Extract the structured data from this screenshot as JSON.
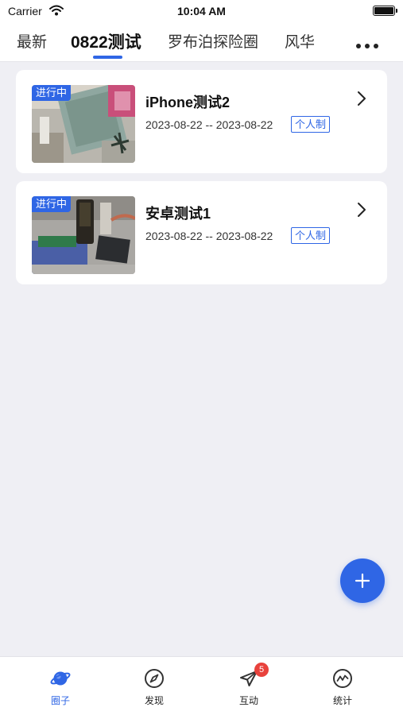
{
  "status_bar": {
    "carrier": "Carrier",
    "time": "10:04 AM",
    "icons": [
      "wifi-icon",
      "battery-icon"
    ]
  },
  "tabs": [
    {
      "label": "最新",
      "active": false
    },
    {
      "label": "0822测试",
      "active": true
    },
    {
      "label": "罗布泊探险圈",
      "active": false
    },
    {
      "label": "风华",
      "active": false
    }
  ],
  "more_icon": "ellipsis-icon",
  "accent_color": "#2f66e5",
  "cards": [
    {
      "status_badge": "进行中",
      "title": "iPhone测试2",
      "date_range": "2023-08-22 -- 2023-08-22",
      "tag": "个人制"
    },
    {
      "status_badge": "进行中",
      "title": "安卓测试1",
      "date_range": "2023-08-22 -- 2023-08-22",
      "tag": "个人制"
    }
  ],
  "fab_icon": "plus-icon",
  "bottom_nav": [
    {
      "label": "圈子",
      "icon": "planet-icon",
      "active": true
    },
    {
      "label": "发现",
      "icon": "compass-icon",
      "active": false
    },
    {
      "label": "互动",
      "icon": "paper-plane-icon",
      "active": false,
      "badge": "5"
    },
    {
      "label": "统计",
      "icon": "chart-trend-icon",
      "active": false
    }
  ]
}
